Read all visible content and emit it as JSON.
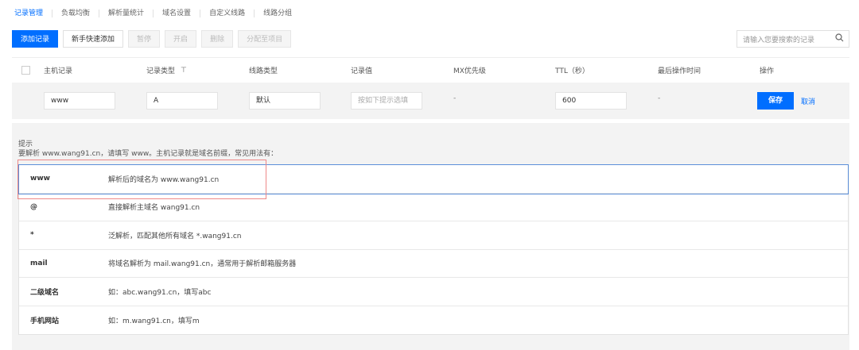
{
  "tabs": [
    "记录管理",
    "负载均衡",
    "解析量统计",
    "域名设置",
    "自定义线路",
    "线路分组"
  ],
  "toolbar": {
    "add": "添加记录",
    "quick_add": "新手快速添加",
    "pause": "暂停",
    "enable": "开启",
    "delete": "删除",
    "assign": "分配至项目"
  },
  "search": {
    "placeholder": "请输入您要搜索的记录"
  },
  "columns": [
    "主机记录",
    "记录类型",
    "线路类型",
    "记录值",
    "MX优先级",
    "TTL（秒）",
    "最后操作时间",
    "操作"
  ],
  "edit_row": {
    "host": "www",
    "type": "A",
    "line": "默认",
    "value_placeholder": "按如下提示选填",
    "mx": "-",
    "ttl": "600",
    "last_op": "-",
    "save": "保存",
    "cancel": "取消"
  },
  "hint": {
    "title": "提示",
    "desc": "要解析 www.wang91.cn，请填写 www。主机记录就是域名前缀，常见用法有：",
    "items": [
      {
        "key": "www",
        "desc": "解析后的域名为 www.wang91.cn"
      },
      {
        "key": "@",
        "desc": "直接解析主域名 wang91.cn"
      },
      {
        "key": "*",
        "desc": "泛解析，匹配其他所有域名 *.wang91.cn"
      },
      {
        "key": "mail",
        "desc": "将域名解析为 mail.wang91.cn，通常用于解析邮箱服务器"
      },
      {
        "key": "二级域名",
        "desc": "如：abc.wang91.cn，填写abc"
      },
      {
        "key": "手机网站",
        "desc": "如：m.wang91.cn，填写m"
      }
    ]
  },
  "colors": {
    "accent": "#006eff",
    "highlight": "#e88888"
  }
}
